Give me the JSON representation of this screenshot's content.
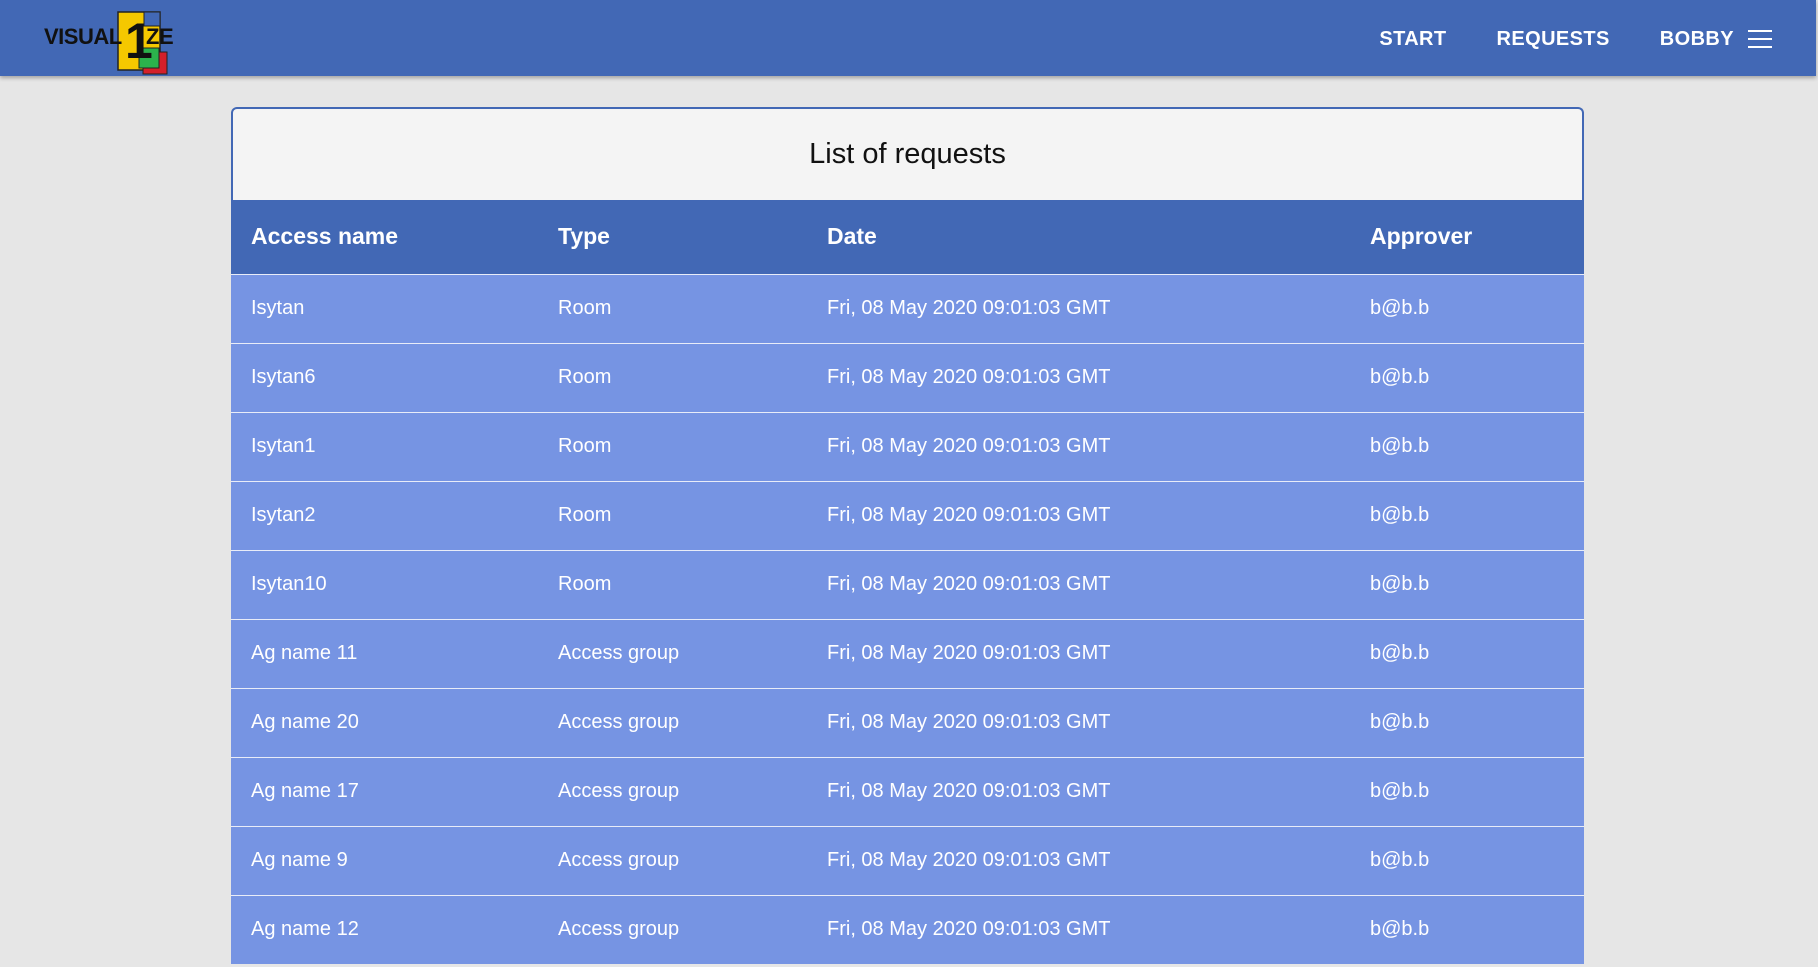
{
  "app": {
    "logo_left": "VISUAL",
    "logo_digit": "1",
    "logo_right": "ZE"
  },
  "nav": {
    "start": "START",
    "requests": "REQUESTS",
    "user": "BOBBY"
  },
  "icons": {
    "menu": "hamburger-icon"
  },
  "colors": {
    "brand": "#4268b5",
    "row": "#7694e3",
    "background": "#e6e6e6",
    "logo_yellow": "#f5c800",
    "logo_green": "#2bb24c",
    "logo_red": "#d4202a"
  },
  "page": {
    "title": "List of requests"
  },
  "table": {
    "headers": [
      "Access name",
      "Type",
      "Date",
      "Approver"
    ],
    "rows": [
      [
        "Isytan",
        "Room",
        "Fri, 08 May 2020 09:01:03 GMT",
        "b@b.b"
      ],
      [
        "Isytan6",
        "Room",
        "Fri, 08 May 2020 09:01:03 GMT",
        "b@b.b"
      ],
      [
        "Isytan1",
        "Room",
        "Fri, 08 May 2020 09:01:03 GMT",
        "b@b.b"
      ],
      [
        "Isytan2",
        "Room",
        "Fri, 08 May 2020 09:01:03 GMT",
        "b@b.b"
      ],
      [
        "Isytan10",
        "Room",
        "Fri, 08 May 2020 09:01:03 GMT",
        "b@b.b"
      ],
      [
        "Ag name 11",
        "Access group",
        "Fri, 08 May 2020 09:01:03 GMT",
        "b@b.b"
      ],
      [
        "Ag name 20",
        "Access group",
        "Fri, 08 May 2020 09:01:03 GMT",
        "b@b.b"
      ],
      [
        "Ag name 17",
        "Access group",
        "Fri, 08 May 2020 09:01:03 GMT",
        "b@b.b"
      ],
      [
        "Ag name 9",
        "Access group",
        "Fri, 08 May 2020 09:01:03 GMT",
        "b@b.b"
      ],
      [
        "Ag name 12",
        "Access group",
        "Fri, 08 May 2020 09:01:03 GMT",
        "b@b.b"
      ]
    ]
  }
}
